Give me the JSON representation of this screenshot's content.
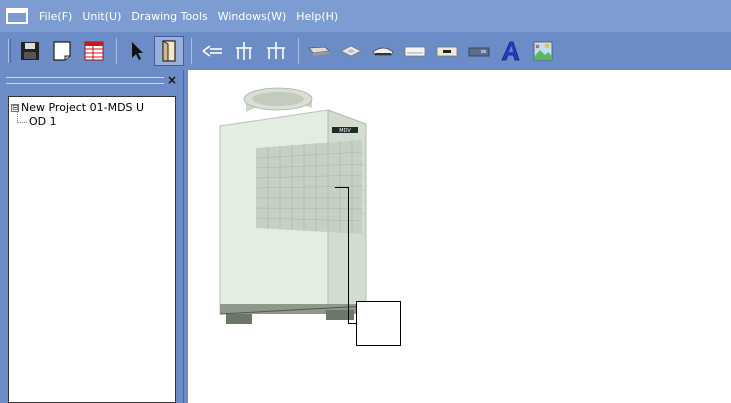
{
  "menu": {
    "items": [
      "File(F)",
      "Unit(U)",
      "Drawing Tools",
      "Windows(W)",
      "Help(H)"
    ]
  },
  "toolbar": {
    "buttons": [
      {
        "name": "save-icon",
        "active": false
      },
      {
        "name": "new-page-icon",
        "active": false
      },
      {
        "name": "table-icon",
        "active": false
      },
      {
        "name": "pointer-icon",
        "active": false
      },
      {
        "name": "door-icon",
        "active": true
      },
      {
        "name": "branch-joint-icon",
        "active": false
      },
      {
        "name": "header-joint-icon",
        "active": false
      },
      {
        "name": "header-joint-2-icon",
        "active": false
      },
      {
        "name": "duct-unit-icon",
        "active": false
      },
      {
        "name": "cassette-unit-icon",
        "active": false
      },
      {
        "name": "ceiling-unit-icon",
        "active": false
      },
      {
        "name": "wall-unit-icon",
        "active": false
      },
      {
        "name": "controller-icon",
        "active": false
      },
      {
        "name": "remote-icon",
        "active": false
      },
      {
        "name": "text-tool-icon",
        "active": false
      },
      {
        "name": "picture-icon",
        "active": false
      }
    ]
  },
  "tree": {
    "root_label": "New Project 01-MDS U",
    "expander": "⊟",
    "children": [
      "OD 1"
    ]
  },
  "panel": {
    "close_glyph": "×"
  },
  "canvas": {
    "unit_brand": "MDV",
    "unit_color": "#e4ede2"
  }
}
